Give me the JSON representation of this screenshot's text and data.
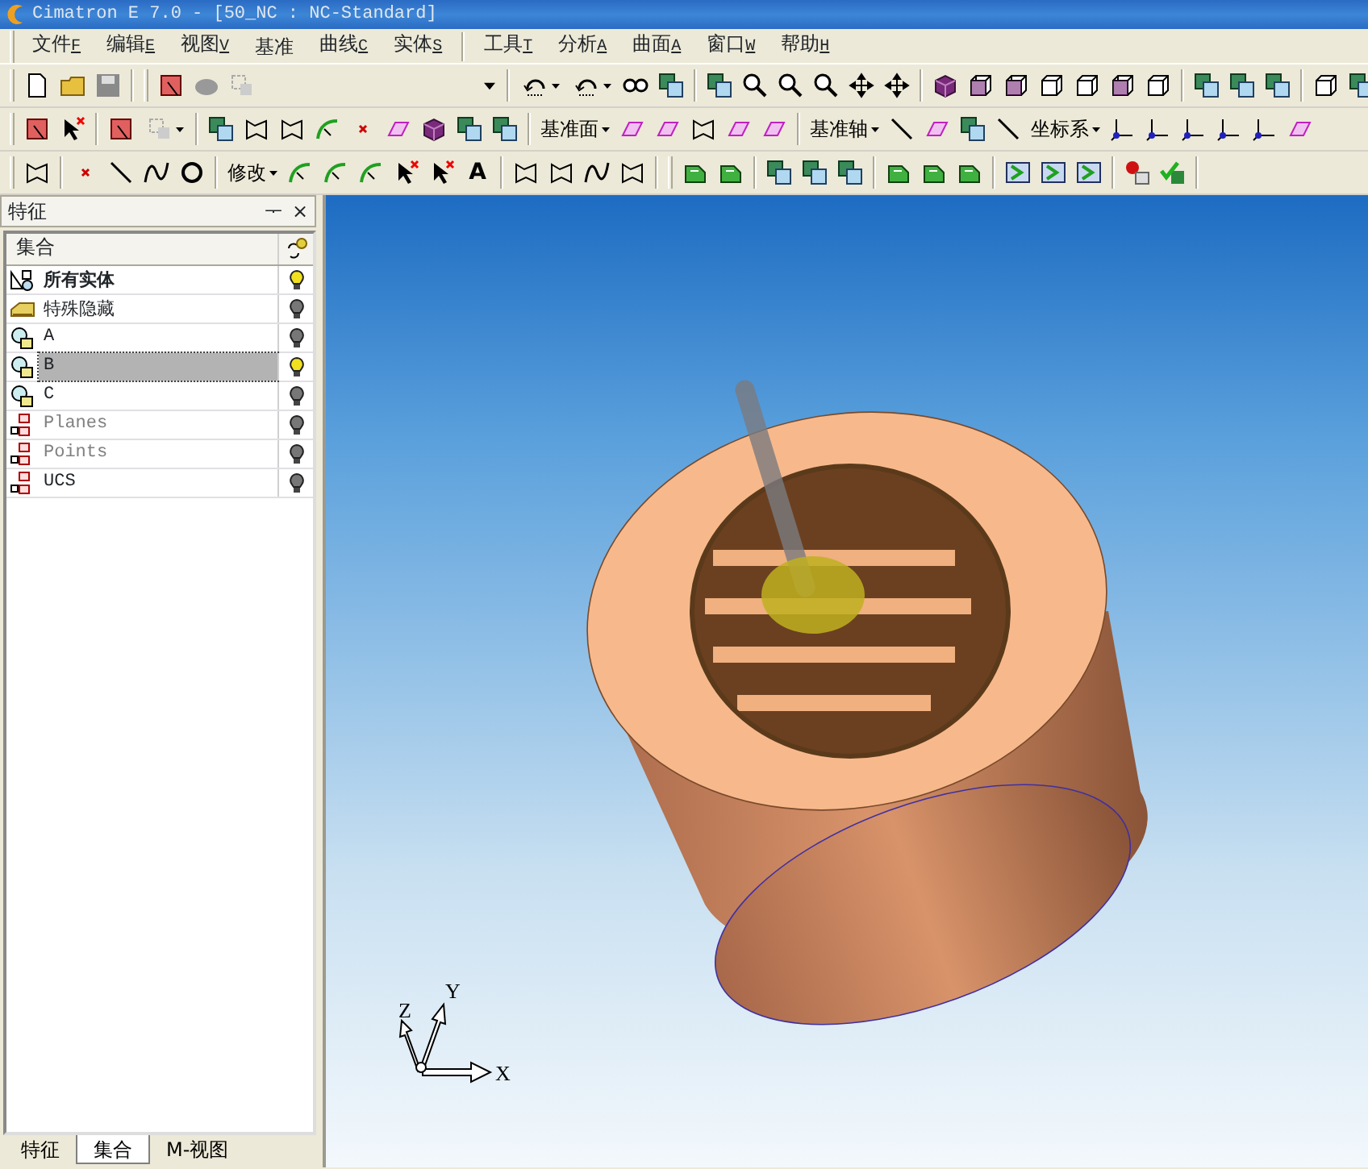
{
  "window": {
    "title": "Cimatron E 7.0 - [50_NC : NC-Standard]"
  },
  "menu": [
    {
      "label": "文件",
      "key": "F"
    },
    {
      "label": "编辑",
      "key": "E"
    },
    {
      "label": "视图",
      "key": "V"
    },
    {
      "label": "基准"
    },
    {
      "label": "曲线",
      "key": "C"
    },
    {
      "label": "实体",
      "key": "S"
    },
    {
      "label": "工具",
      "key": "T"
    },
    {
      "label": "分析",
      "key": "A"
    },
    {
      "label": "曲面",
      "key": "A"
    },
    {
      "label": "窗口",
      "key": "W"
    },
    {
      "label": "帮助",
      "key": "H"
    }
  ],
  "toolbars": [
    [
      {
        "kind": "grip"
      },
      {
        "kind": "button"
      },
      {
        "kind": "button"
      },
      {
        "kind": "button"
      },
      {
        "kind": "sep"
      },
      {
        "kind": "grip"
      },
      {
        "kind": "button"
      },
      {
        "kind": "button"
      },
      {
        "kind": "button"
      },
      {
        "kind": "combo"
      },
      {
        "kind": "sep"
      },
      {
        "kind": "split"
      },
      {
        "kind": "split"
      },
      {
        "kind": "button"
      },
      {
        "kind": "button"
      },
      {
        "kind": "sep"
      },
      {
        "kind": "button"
      },
      {
        "kind": "button"
      },
      {
        "kind": "button"
      },
      {
        "kind": "button"
      },
      {
        "kind": "button"
      },
      {
        "kind": "button"
      },
      {
        "kind": "sep"
      },
      {
        "kind": "button"
      },
      {
        "kind": "button"
      },
      {
        "kind": "button"
      },
      {
        "kind": "button"
      },
      {
        "kind": "button"
      },
      {
        "kind": "button"
      },
      {
        "kind": "button"
      },
      {
        "kind": "sep"
      },
      {
        "kind": "button"
      },
      {
        "kind": "button"
      },
      {
        "kind": "button"
      },
      {
        "kind": "sep"
      },
      {
        "kind": "button"
      },
      {
        "kind": "button"
      }
    ],
    [
      {
        "kind": "grip"
      },
      {
        "kind": "button"
      },
      {
        "kind": "button"
      },
      {
        "kind": "sep"
      },
      {
        "kind": "button"
      },
      {
        "kind": "split"
      },
      {
        "kind": "sep"
      },
      {
        "kind": "button"
      },
      {
        "kind": "button"
      },
      {
        "kind": "button"
      },
      {
        "kind": "button"
      },
      {
        "kind": "button"
      },
      {
        "kind": "button"
      },
      {
        "kind": "button"
      },
      {
        "kind": "button"
      },
      {
        "kind": "button"
      },
      {
        "kind": "sep"
      },
      {
        "kind": "dropdown",
        "label": "基准面"
      },
      {
        "kind": "button"
      },
      {
        "kind": "button"
      },
      {
        "kind": "button"
      },
      {
        "kind": "button"
      },
      {
        "kind": "button"
      },
      {
        "kind": "sep"
      },
      {
        "kind": "dropdown",
        "label": "基准轴"
      },
      {
        "kind": "button"
      },
      {
        "kind": "button"
      },
      {
        "kind": "button"
      },
      {
        "kind": "button"
      },
      {
        "kind": "dropdown",
        "label": "坐标系"
      },
      {
        "kind": "button"
      },
      {
        "kind": "button"
      },
      {
        "kind": "button"
      },
      {
        "kind": "button"
      },
      {
        "kind": "button"
      },
      {
        "kind": "button"
      }
    ],
    [
      {
        "kind": "grip"
      },
      {
        "kind": "button"
      },
      {
        "kind": "sep"
      },
      {
        "kind": "button"
      },
      {
        "kind": "button"
      },
      {
        "kind": "button"
      },
      {
        "kind": "button"
      },
      {
        "kind": "sep"
      },
      {
        "kind": "dropdown",
        "label": "修改"
      },
      {
        "kind": "button"
      },
      {
        "kind": "button"
      },
      {
        "kind": "button"
      },
      {
        "kind": "button"
      },
      {
        "kind": "button"
      },
      {
        "kind": "glyph",
        "label": "A"
      },
      {
        "kind": "sep"
      },
      {
        "kind": "button"
      },
      {
        "kind": "button"
      },
      {
        "kind": "button"
      },
      {
        "kind": "button"
      },
      {
        "kind": "sep"
      },
      {
        "kind": "grip"
      },
      {
        "kind": "button"
      },
      {
        "kind": "button"
      },
      {
        "kind": "sep"
      },
      {
        "kind": "button"
      },
      {
        "kind": "button"
      },
      {
        "kind": "button"
      },
      {
        "kind": "sep"
      },
      {
        "kind": "button"
      },
      {
        "kind": "button"
      },
      {
        "kind": "button"
      },
      {
        "kind": "sep"
      },
      {
        "kind": "button"
      },
      {
        "kind": "button"
      },
      {
        "kind": "button"
      },
      {
        "kind": "sep"
      },
      {
        "kind": "button"
      },
      {
        "kind": "button"
      },
      {
        "kind": "sep"
      }
    ]
  ],
  "panel": {
    "title": "特征",
    "pin": "ᅮ",
    "close": "×",
    "header": "集合",
    "rows": [
      {
        "label": "所有实体",
        "kind": "all",
        "lit": true,
        "selected": false,
        "dimmed": false
      },
      {
        "label": "特殊隐藏",
        "kind": "hidden",
        "lit": false,
        "selected": false,
        "dimmed": false
      },
      {
        "label": "A",
        "kind": "set",
        "lit": false,
        "selected": false,
        "dimmed": false
      },
      {
        "label": "B",
        "kind": "set",
        "lit": true,
        "selected": true,
        "dimmed": false
      },
      {
        "label": "C",
        "kind": "set",
        "lit": false,
        "selected": false,
        "dimmed": false
      },
      {
        "label": "Planes",
        "kind": "group",
        "lit": false,
        "selected": false,
        "dimmed": true
      },
      {
        "label": "Points",
        "kind": "group",
        "lit": false,
        "selected": false,
        "dimmed": true
      },
      {
        "label": "UCS",
        "kind": "group",
        "lit": false,
        "selected": false,
        "dimmed": false
      }
    ],
    "tabs": [
      {
        "label": "特征",
        "selected": false
      },
      {
        "label": "集合",
        "selected": true
      },
      {
        "label": "M-视图",
        "selected": false
      }
    ]
  },
  "viewport": {
    "axes": {
      "x": "X",
      "y": "Y",
      "z": "Z"
    }
  }
}
